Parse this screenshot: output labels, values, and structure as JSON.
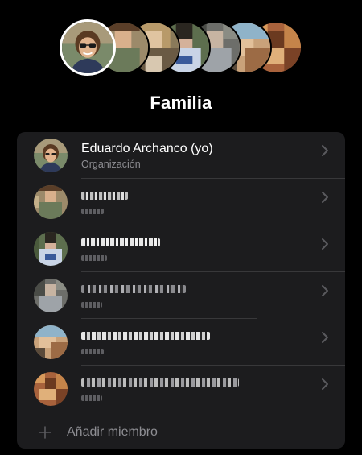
{
  "header": {
    "title": "Familia"
  },
  "members": [
    {
      "name": "Eduardo Archanco (yo)",
      "role": "Organización",
      "avatar": "eduardo-avatar"
    },
    {
      "name": "",
      "role": "",
      "avatar": "member-avatar-2"
    },
    {
      "name": "",
      "role": "",
      "avatar": "member-avatar-3"
    },
    {
      "name": "",
      "role": "",
      "avatar": "member-avatar-4"
    },
    {
      "name": "",
      "role": "",
      "avatar": "member-avatar-5"
    },
    {
      "name": "",
      "role": "",
      "avatar": "member-avatar-6"
    }
  ],
  "add_member": {
    "label": "Añadir miembro"
  },
  "icons": {
    "chevron": "chevron-right-icon",
    "plus": "plus-icon"
  },
  "colors": {
    "background": "#000000",
    "card": "#1c1c1e",
    "secondary_text": "#8e8e93",
    "separator": "#38383a"
  }
}
